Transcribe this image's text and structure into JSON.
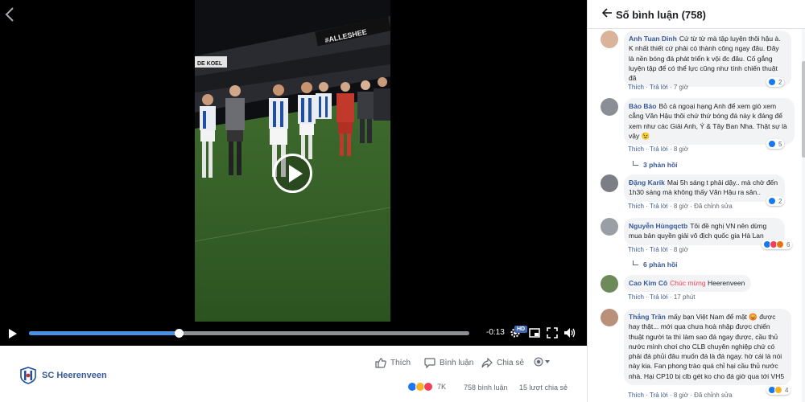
{
  "video": {
    "stadium_banner": "#ALLESHEE",
    "ad_board": "DE KOEL",
    "progress": 0.34,
    "time_remaining": "-0:13",
    "hd_label": "HD"
  },
  "post": {
    "page_name": "SC Heerenveen",
    "actions": {
      "like": "Thích",
      "comment": "Bình luận",
      "share": "Chia sẻ"
    },
    "reaction_count": "7K",
    "comment_count": "758 bình luận",
    "share_count": "15 lượt chia sẻ"
  },
  "panel": {
    "title": "Số bình luận (758)"
  },
  "comments": [
    {
      "author": "Anh Tuan Dinh",
      "text": "Cứ từ từ mà tập luyện thôi hậu à. K nhất thiết cứ phải có thành công ngay đâu. Đây là nền bóng đá phát triển k vội đc đâu. Cố gắng luyện tập để có thể lực cũng như tính chiến thuật đã",
      "reactions": "2",
      "like": "Thích",
      "reply": "Trả lời",
      "time": "7 giờ"
    },
    {
      "author": "Bảo Bảo",
      "text": "Bỏ cả ngoại hạng Anh để xem giò xem cẳng Văn Hậu thôi chứ thứ bóng đá này k đáng để xem như các Giải Anh, Ý & Tây Ban Nha. Thật sự là vậy 😉",
      "reactions": "5",
      "like": "Thích",
      "reply": "Trả lời",
      "time": "8 giờ",
      "replies": "3 phản hồi"
    },
    {
      "author": "Đặng Karik",
      "text": "Mai 5h sáng t phải dậy.. mà chờ đến 1h30 sáng mà không thấy Văn Hậu ra sân..",
      "reactions": "2",
      "like": "Thích",
      "reply": "Trả lời",
      "time": "8 giờ",
      "edited": "Đã chỉnh sửa"
    },
    {
      "author": "Nguyễn Hùngqctb",
      "text": "Tôi đề nghị VN nên dừng mua bản quyền giải vô địch quốc gia Hà Lan",
      "reactions": "6",
      "like": "Thích",
      "reply": "Trả lời",
      "time": "8 giờ",
      "replies": "6 phản hồi"
    },
    {
      "author": "Cao Kim Cô",
      "tag": "Chúc mừng",
      "text": "Heerenveen",
      "like": "Thích",
      "reply": "Trả lời",
      "time": "17 phút"
    },
    {
      "author": "Thắng Trần",
      "text": "mấy bạn Việt Nam để mặt 😡 được hay thật... mới qua chưa hoà nhập được chiến thuật người ta thì làm sao đá ngay được, cầu thủ nước mình chơi cho CLB chuyên nghiệp chứ có phải đá phủi đâu muốn đá là đá ngay. hờ cái là nói này kia. Fan phong trào quá chỉ hại cầu thủ nước nhà. Hại CP10 bị clb gét ko cho đá giờ qua tới VH5",
      "reactions": "4",
      "like": "Thích",
      "reply": "Trả lời",
      "time": "8 giờ",
      "edited": "Đã chỉnh sửa"
    }
  ],
  "colors": {
    "like_blue": "#1877f2",
    "love_red": "#f33e58",
    "haha_yellow": "#f7b125",
    "link_blue": "#385898",
    "progress_blue": "#4a90e2"
  },
  "icons": [
    "back-arrow-icon",
    "play-icon",
    "settings-icon",
    "fullscreen-icon",
    "volume-icon",
    "like-icon",
    "comment-icon",
    "share-icon",
    "audience-icon"
  ]
}
